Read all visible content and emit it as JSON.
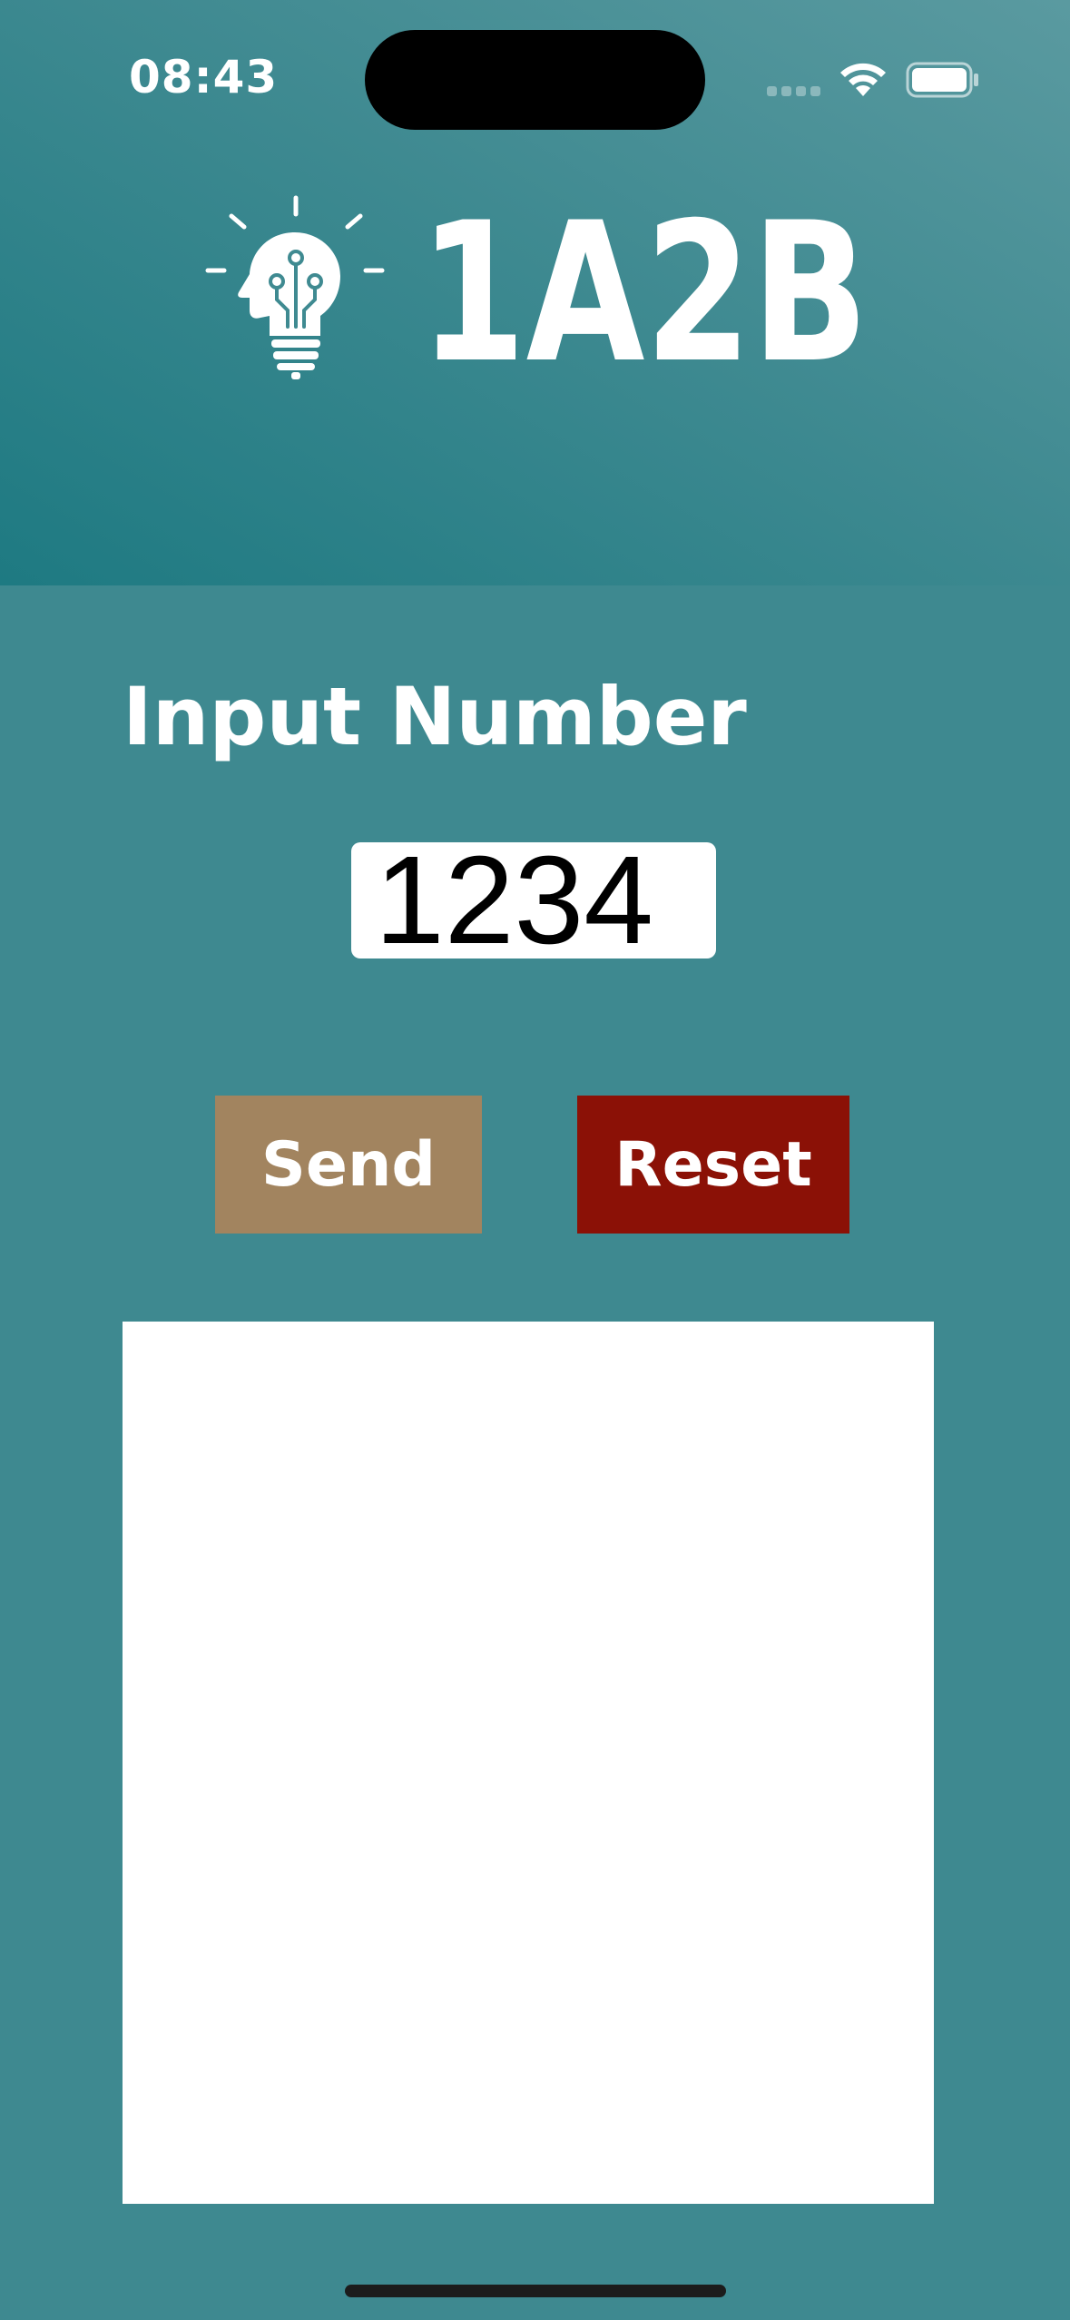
{
  "status_bar": {
    "time": "08:43",
    "icons": [
      "cellular-signal-icon",
      "wifi-icon",
      "battery-icon"
    ]
  },
  "header": {
    "logo_icon": "lightbulb-head-circuit-icon",
    "logo_text": "1A2B",
    "gradient_colors": [
      "#5a9aa0",
      "#1e7a82"
    ]
  },
  "main": {
    "title": "Input Number",
    "number_input": {
      "value": "1234"
    },
    "send_button": {
      "label": "Send",
      "color": "#a2845f"
    },
    "reset_button": {
      "label": "Reset",
      "color": "#8b1106"
    },
    "results": []
  },
  "colors": {
    "background": "#3e8990",
    "text": "#ffffff",
    "panel": "#ffffff"
  }
}
